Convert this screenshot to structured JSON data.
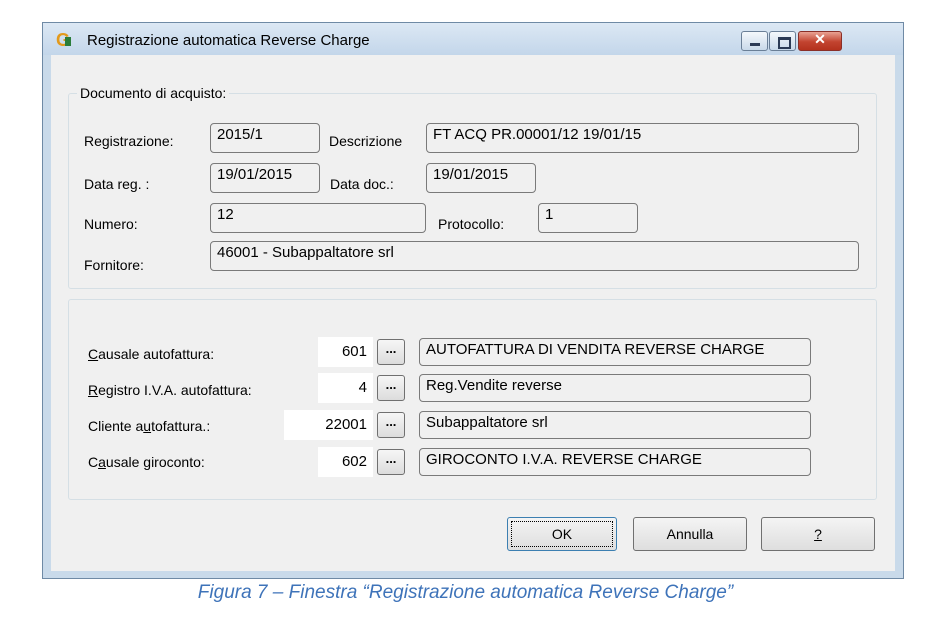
{
  "window": {
    "title": "Registrazione automatica Reverse Charge",
    "close_glyph": "✕"
  },
  "documento": {
    "group_title": "Documento di acquisto:",
    "registrazione_label": "Registrazione:",
    "registrazione_value": "2015/1",
    "descrizione_label": "Descrizione",
    "descrizione_value": "FT ACQ PR.00001/12 19/01/15",
    "data_reg_label": "Data reg. :",
    "data_reg_value": "19/01/2015",
    "data_doc_label": "Data doc.:",
    "data_doc_value": "19/01/2015",
    "numero_label": "Numero:",
    "numero_value": "12",
    "protocollo_label": "Protocollo:",
    "protocollo_value": "1",
    "fornitore_label": "Fornitore:",
    "fornitore_value": "46001 - Subappaltatore srl"
  },
  "autofattura": {
    "causale_label_pre": "",
    "causale_label_u": "C",
    "causale_label_post": "ausale autofattura:",
    "causale_code": "601",
    "causale_desc": "AUTOFATTURA DI VENDITA REVERSE CHARGE",
    "registro_label_u": "R",
    "registro_label_post": "egistro I.V.A. autofattura:",
    "registro_code": "4",
    "registro_desc": "Reg.Vendite reverse",
    "cliente_label_pre": "Cliente a",
    "cliente_label_u": "u",
    "cliente_label_post": "tofattura.:",
    "cliente_code": "22001",
    "cliente_desc": "Subappaltatore srl",
    "giroconto_label_pre": "C",
    "giroconto_label_u": "a",
    "giroconto_label_post": "usale giroconto:",
    "giroconto_code": "602",
    "giroconto_desc": "GIROCONTO I.V.A. REVERSE CHARGE",
    "lookup_label": "..."
  },
  "buttons": {
    "ok": "OK",
    "cancel": "Annulla",
    "help": "?"
  },
  "caption": "Figura 7 – Finestra “Registrazione automatica Reverse Charge”"
}
